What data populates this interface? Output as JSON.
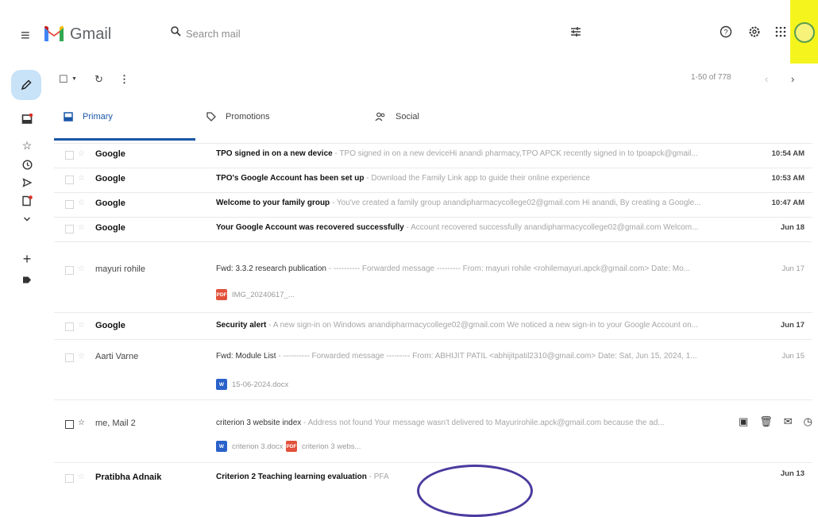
{
  "header": {
    "brand": "Gmail",
    "search_placeholder": "Search mail"
  },
  "toolbar": {
    "pagination": "1-50 of 778"
  },
  "tabs": [
    {
      "label": "Primary",
      "icon": "inbox-icon"
    },
    {
      "label": "Promotions",
      "icon": "tag-icon"
    },
    {
      "label": "Social",
      "icon": "people-icon"
    }
  ],
  "colors": {
    "accent": "#1a56a8",
    "avatar_highlight": "#f5f51d",
    "compose_bg": "#c8e2f7",
    "gmail_red": "#ea4335"
  },
  "emails": [
    {
      "sender": "Google",
      "subject": "TPO signed in on a new device",
      "snippet": " - TPO signed in on a new deviceHi anandi pharmacy,TPO APCK recently signed in to tpoapck@gmail...",
      "date": "10:54 AM",
      "unread": true
    },
    {
      "sender": "Google",
      "subject": "TPO's Google Account has been set up",
      "snippet": " - Download the Family Link app to guide their online experience",
      "date": "10:53 AM",
      "unread": true
    },
    {
      "sender": "Google",
      "subject": "Welcome to your family group",
      "snippet": " - You've created a family group anandipharmacycollege02@gmail.com Hi anandi, By creating a Google...",
      "date": "10:47 AM",
      "unread": true
    },
    {
      "sender": "Google",
      "subject": "Your Google Account was recovered successfully",
      "snippet": " - Account recovered successfully anandipharmacycollege02@gmail.com Welcom...",
      "date": "Jun 18",
      "unread": true
    },
    {
      "sender": "mayuri rohile",
      "subject": "Fwd: 3.3.2 research publication",
      "snippet": " - ---------- Forwarded message --------- From: mayuri rohile <rohilemayuri.apck@gmail.com> Date: Mo...",
      "date": "Jun 17",
      "unread": false,
      "attachment": "IMG_20240617_..."
    },
    {
      "sender": "Google",
      "subject": "Security alert",
      "snippet": " - A new sign-in on Windows anandipharmacycollege02@gmail.com We noticed a new sign-in to your Google Account on...",
      "date": "Jun 17",
      "unread": true
    },
    {
      "sender": "Aarti Varne",
      "subject": "Fwd: Module List",
      "snippet": " - ---------- Forwarded message --------- From: ABHIJIT PATIL <abhijitpatil2310@gmail.com> Date: Sat, Jun 15, 2024, 1...",
      "date": "Jun 15",
      "unread": false,
      "attachment": "15-06-2024.docx"
    },
    {
      "sender": "me, Mail 2",
      "subject": "criterion 3 website index",
      "snippet": " - Address not found Your message wasn't delivered to Mayurirohile.apck@gmail.com because the ad...",
      "date": "",
      "unread": false,
      "attachments": [
        "criterion 3.docx",
        "criterion 3 webs..."
      ]
    },
    {
      "sender": "Pratibha Adnaik",
      "subject": "Criterion 2 Teaching learning evaluation",
      "snippet": " - PFA",
      "date": "Jun 13",
      "unread": true
    }
  ]
}
